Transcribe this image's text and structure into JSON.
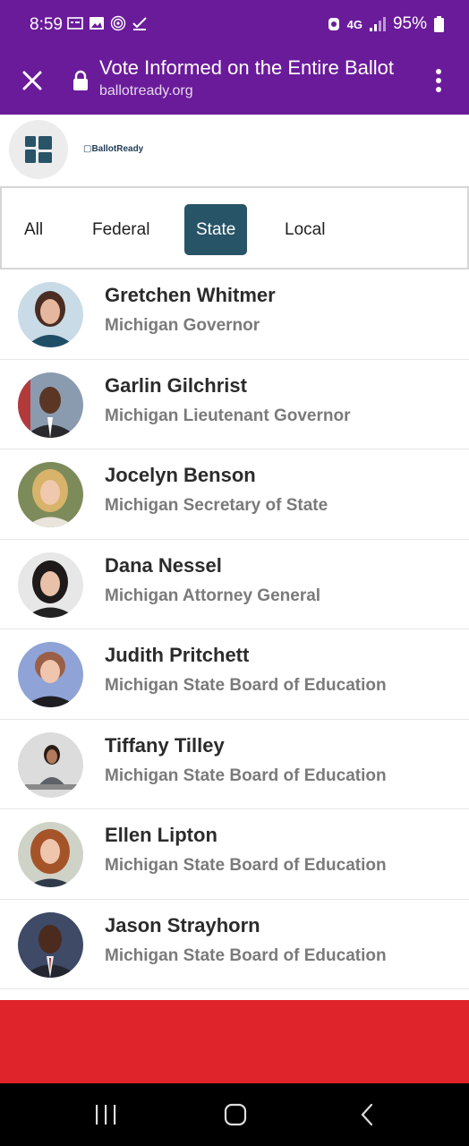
{
  "status": {
    "time": "8:59",
    "network": "4G",
    "battery": "95%"
  },
  "browser": {
    "title": "Vote Informed on the Entire Ballot",
    "domain": "ballotready.org"
  },
  "site": {
    "brand": "BallotReady"
  },
  "tabs": [
    {
      "label": "All",
      "active": false
    },
    {
      "label": "Federal",
      "active": false
    },
    {
      "label": "State",
      "active": true
    },
    {
      "label": "Local",
      "active": false
    }
  ],
  "candidates": [
    {
      "name": "Gretchen Whitmer",
      "office": "Michigan Governor"
    },
    {
      "name": "Garlin Gilchrist",
      "office": "Michigan Lieutenant Governor"
    },
    {
      "name": "Jocelyn Benson",
      "office": "Michigan Secretary of State"
    },
    {
      "name": "Dana Nessel",
      "office": "Michigan Attorney General"
    },
    {
      "name": "Judith Pritchett",
      "office": "Michigan State Board of Education"
    },
    {
      "name": "Tiffany Tilley",
      "office": "Michigan State Board of Education"
    },
    {
      "name": "Ellen Lipton",
      "office": "Michigan State Board of Education"
    },
    {
      "name": "Jason Strayhorn",
      "office": "Michigan State Board of Education"
    }
  ],
  "colors": {
    "toolbar": "#6a1b9a",
    "active_tab": "#285467",
    "banner": "#e0242b"
  }
}
